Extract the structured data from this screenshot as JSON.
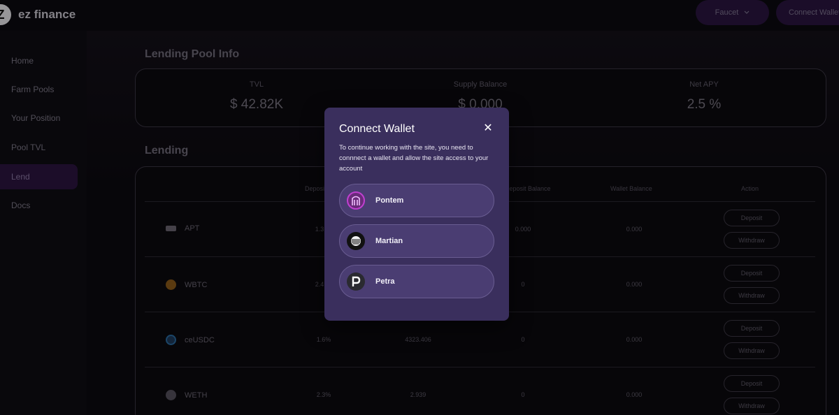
{
  "app": {
    "logo_letter": "Z",
    "name": "ez finance"
  },
  "header": {
    "faucet_label": "Faucet",
    "connect_label": "Connect Wallet"
  },
  "sidebar": {
    "items": [
      {
        "label": "Home",
        "icon": "home-icon"
      },
      {
        "label": "Farm Pools",
        "icon": "farm-icon"
      },
      {
        "label": "Your Position",
        "icon": "position-icon"
      },
      {
        "label": "Pool TVL",
        "icon": "chart-icon"
      },
      {
        "label": "Lend",
        "icon": "lend-icon",
        "active": true
      },
      {
        "label": "Docs",
        "icon": "docs-icon"
      }
    ]
  },
  "pool_info": {
    "title": "Lending Pool Info",
    "stats": [
      {
        "label": "TVL",
        "value": "$ 42.82K"
      },
      {
        "label": "Supply Balance",
        "value": "$ 0.000"
      },
      {
        "label": "Net APY",
        "value": "2.5 %"
      }
    ]
  },
  "lending": {
    "title": "Lending",
    "columns": [
      "Deposit",
      "",
      "Deposit Balance",
      "Wallet Balance",
      "Action"
    ],
    "rows": [
      {
        "asset": "APT",
        "apy": "1.3",
        "tvl": "",
        "deposit_balance": "0.000",
        "wallet_balance": "0.000",
        "icon_color": "#8a8590"
      },
      {
        "asset": "WBTC",
        "apy": "2.4",
        "tvl": "",
        "deposit_balance": "0",
        "wallet_balance": "0.000",
        "icon_color": "#8a5a1a"
      },
      {
        "asset": "ceUSDC",
        "apy": "1.6%",
        "tvl": "4323.406",
        "deposit_balance": "0",
        "wallet_balance": "0.000",
        "icon_color": "#2a5a8a"
      },
      {
        "asset": "WETH",
        "apy": "2.3%",
        "tvl": "2.939",
        "deposit_balance": "0",
        "wallet_balance": "0.000",
        "icon_color": "#6a6570"
      }
    ],
    "deposit_label": "Deposit",
    "withdraw_label": "Withdraw"
  },
  "modal": {
    "title": "Connect Wallet",
    "close_glyph": "✕",
    "description": "To continue working with the site, you need to connnect a wallet and allow the site access to your account",
    "wallets": [
      {
        "name": "Pontem",
        "icon": "pontem-icon",
        "bg": "#5a2a6a"
      },
      {
        "name": "Martian",
        "icon": "martian-icon",
        "bg": "#1a1a1e"
      },
      {
        "name": "Petra",
        "icon": "petra-icon",
        "bg": "#2a2a30"
      }
    ]
  }
}
